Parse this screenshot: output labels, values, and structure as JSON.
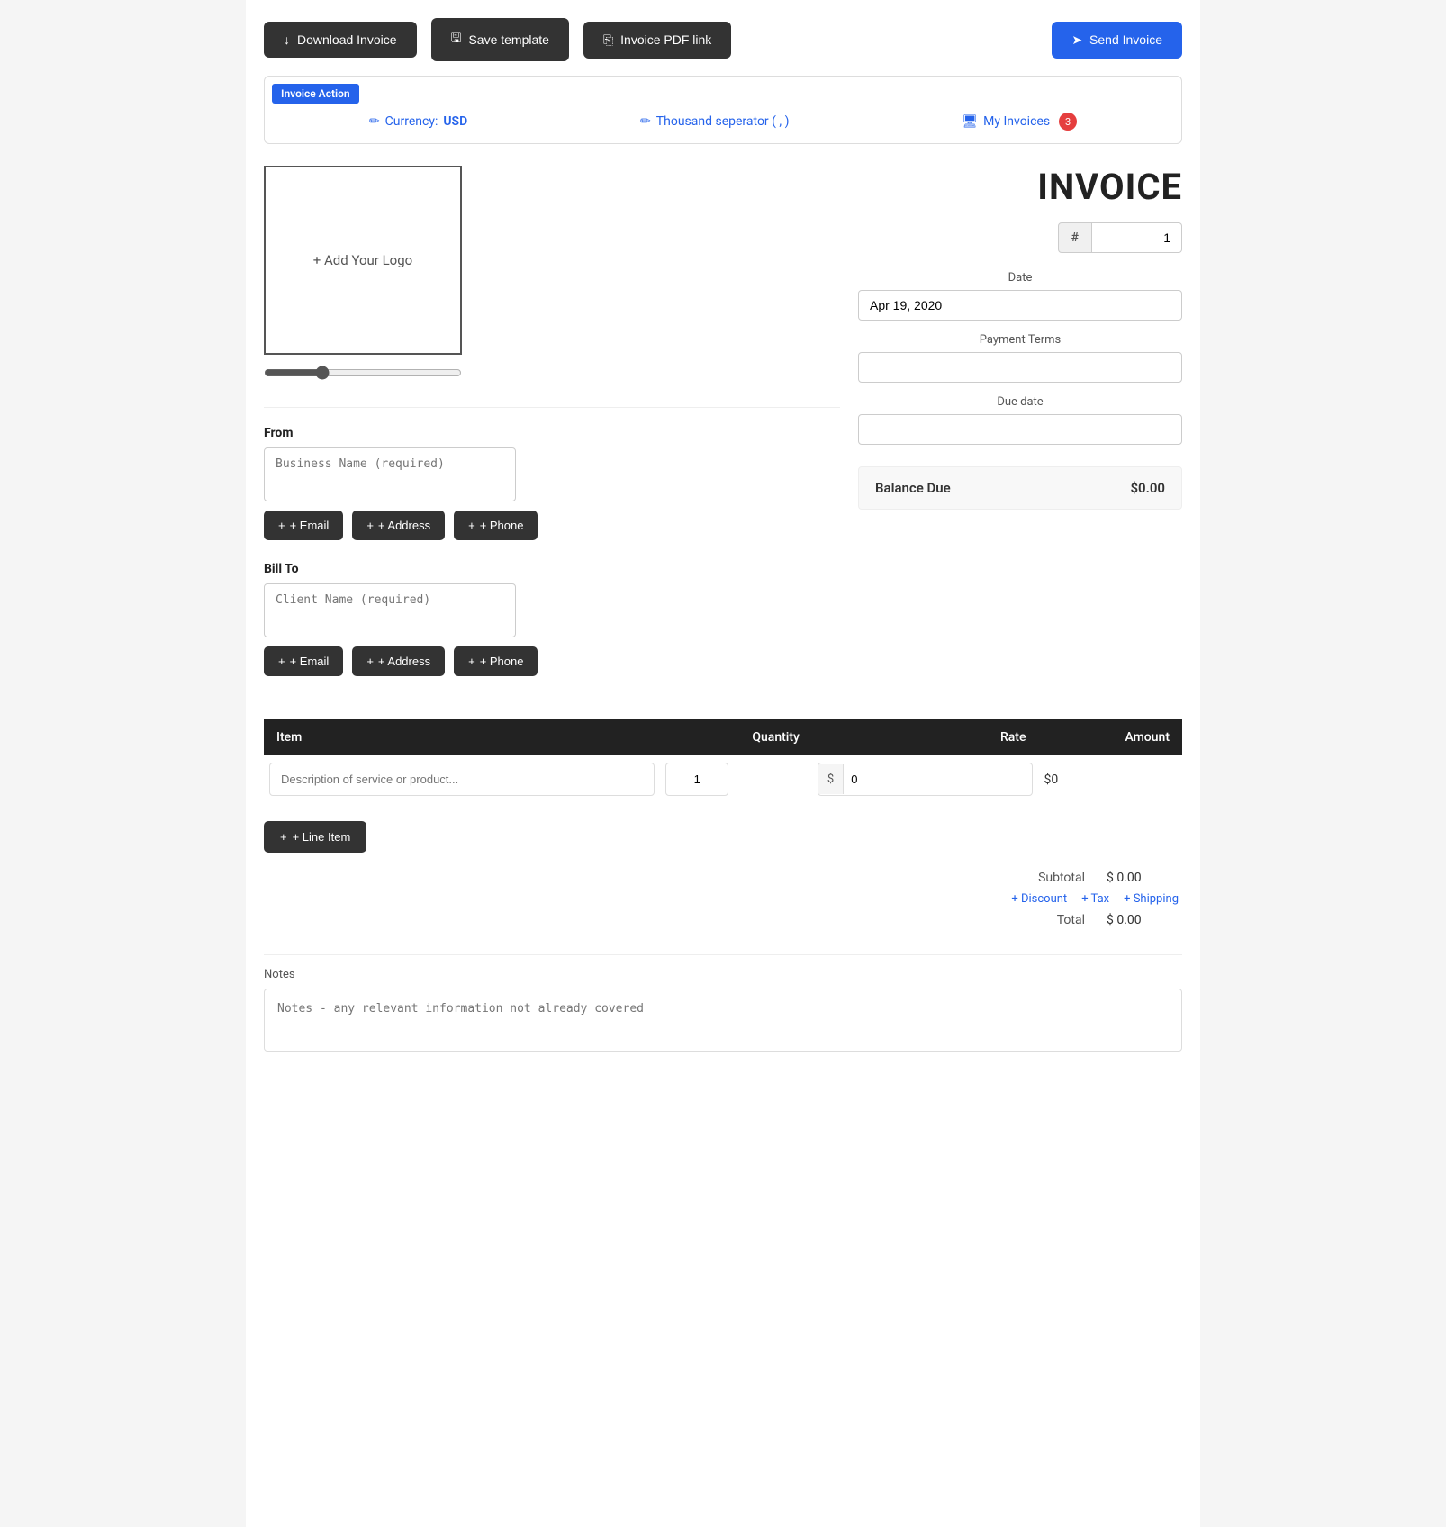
{
  "toolbar": {
    "download_label": "Download Invoice",
    "save_template_label": "Save template",
    "pdf_link_label": "Invoice PDF link",
    "send_label": "Send Invoice",
    "download_icon": "↓",
    "save_icon": "🖫",
    "pdf_icon": "⎘",
    "send_icon": "➤"
  },
  "invoice_action": {
    "tab_label": "Invoice Action",
    "currency_label": "Currency:",
    "currency_value": "USD",
    "currency_icon": "✏",
    "separator_label": "Thousand seperator ( , )",
    "separator_icon": "✏",
    "my_invoices_label": "My Invoices",
    "my_invoices_icon": "🖥",
    "my_invoices_badge": "3"
  },
  "invoice": {
    "title": "INVOICE",
    "logo_placeholder": "+ Add Your Logo",
    "hash_symbol": "#",
    "invoice_number": "1",
    "date_label": "Date",
    "date_value": "Apr 19, 2020",
    "payment_terms_label": "Payment Terms",
    "payment_terms_value": "",
    "due_date_label": "Due date",
    "due_date_value": "",
    "balance_due_label": "Balance Due",
    "balance_due_value": "$0.00"
  },
  "from_section": {
    "label": "From",
    "business_name_placeholder": "Business Name (required)",
    "email_btn": "+ Email",
    "address_btn": "+ Address",
    "phone_btn": "+ Phone"
  },
  "bill_to_section": {
    "label": "Bill To",
    "client_name_placeholder": "Client Name (required)",
    "email_btn": "+ Email",
    "address_btn": "+ Address",
    "phone_btn": "+ Phone"
  },
  "items_table": {
    "col_item": "Item",
    "col_quantity": "Quantity",
    "col_rate": "Rate",
    "col_amount": "Amount",
    "row_description_placeholder": "Description of service or product...",
    "row_qty": "1",
    "row_rate": "0",
    "row_amount": "$0",
    "rate_prefix": "$",
    "add_line_item_label": "+ Line Item"
  },
  "totals": {
    "subtotal_label": "Subtotal",
    "subtotal_value": "$ 0.00",
    "discount_link": "+ Discount",
    "tax_link": "+ Tax",
    "shipping_link": "+ Shipping",
    "total_label": "Total",
    "total_value": "$ 0.00"
  },
  "notes": {
    "label": "Notes",
    "placeholder": "Notes - any relevant information not already covered"
  }
}
